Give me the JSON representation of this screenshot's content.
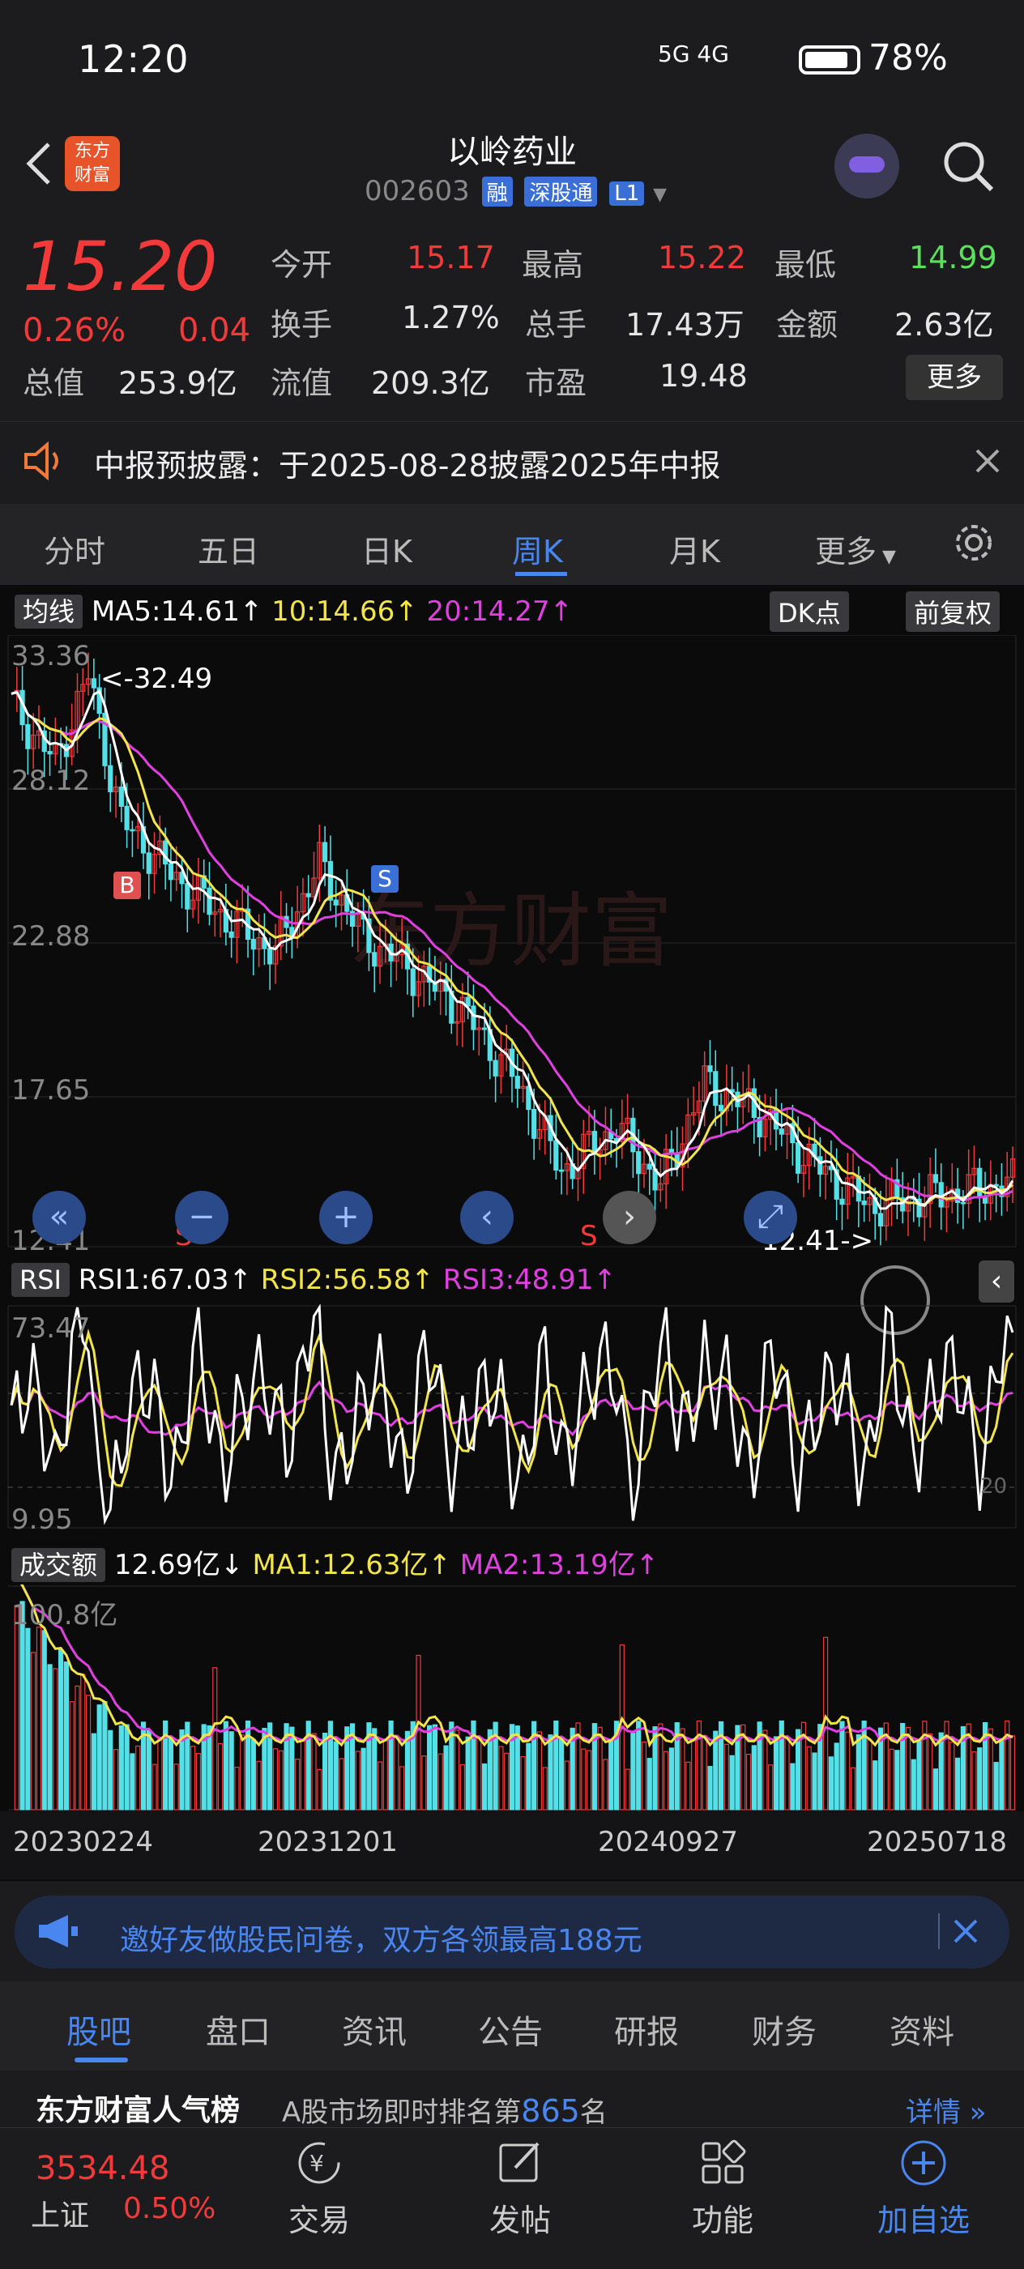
{
  "status": {
    "time": "12:20",
    "network": "5G 4G",
    "battery": "78%"
  },
  "header": {
    "title": "以岭药业",
    "code": "002603",
    "tag1": "融",
    "tag2": "深股通",
    "tag3": "L1"
  },
  "quote": {
    "price": "15.20",
    "pct": "0.26%",
    "change": "0.04",
    "open_label": "今开",
    "open": "15.17",
    "high_label": "最高",
    "high": "15.22",
    "low_label": "最低",
    "low": "14.99",
    "turnover_label": "换手",
    "turnover": "1.27%",
    "volume_label": "总手",
    "volume": "17.43万",
    "amount_label": "金额",
    "amount": "2.63亿",
    "mcap_label": "总值",
    "mcap": "253.9亿",
    "float_label": "流值",
    "float": "209.3亿",
    "pe_label": "市盈",
    "pe": "19.48",
    "more": "更多"
  },
  "notice": {
    "text": "中报预披露：于2025-08-28披露2025年中报"
  },
  "tabs": [
    "分时",
    "五日",
    "日K",
    "周K",
    "月K",
    "更多"
  ],
  "ma_legend": {
    "type": "均线",
    "ma5": "MA5:14.61↑",
    "ma10": "10:14.66↑",
    "ma20": "20:14.27↑",
    "dk": "DK点",
    "fq": "前复权"
  },
  "price_axis": {
    "top": "33.36",
    "y2": "28.12",
    "y3": "22.88",
    "y4": "17.65",
    "bottom": "12.41",
    "max_marker": "<-32.49",
    "min_marker": "12.41->"
  },
  "markers": {
    "b": "B",
    "s": "S",
    "s_low1": "S",
    "s_low2": "S"
  },
  "rsi": {
    "label": "RSI",
    "rsi1": "RSI1:67.03↑",
    "rsi2": "RSI2:56.58↑",
    "rsi3": "RSI3:48.91↑",
    "top": "73.47",
    "bottom": "9.95",
    "line20": "20"
  },
  "vol": {
    "label": "成交额",
    "val": "12.69亿↓",
    "ma1": "MA1:12.63亿↑",
    "ma2": "MA2:13.19亿↑",
    "top": "100.8亿"
  },
  "dates": [
    "20230224",
    "20231201",
    "20240927",
    "20250718"
  ],
  "banner": {
    "text": "邀好友做股民问卷，双方各领最高188元"
  },
  "bottom_tabs": [
    "股吧",
    "盘口",
    "资讯",
    "公告",
    "研报",
    "财务",
    "资料"
  ],
  "rank": {
    "brand": "东方财富人气榜",
    "text": "A股市场即时排名第",
    "num": "865",
    "suffix": "名",
    "detail": "详情"
  },
  "nav": {
    "index_val": "3534.48",
    "index_name": "上证",
    "index_pct": "0.50%",
    "trade": "交易",
    "post": "发帖",
    "func": "功能",
    "add": "加自选"
  },
  "watermark": "东方财富",
  "colors": {
    "up": "#f23a3a",
    "down": "#55e0e8",
    "ma5": "#ffffff",
    "ma10": "#f2e54a",
    "ma20": "#e040e0",
    "accent": "#4a86f0"
  }
}
